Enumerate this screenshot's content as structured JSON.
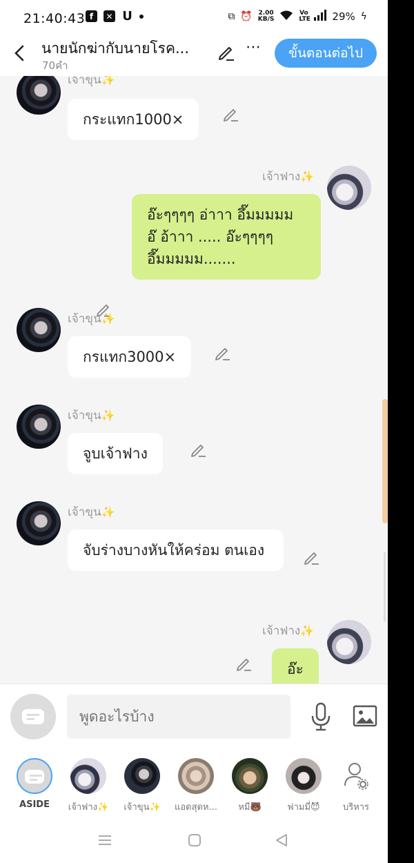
{
  "status_bar": {
    "time": "21:40:43",
    "app_icons": [
      "facebook-icon",
      "capcut-icon",
      "u-icon",
      "dot-icon"
    ],
    "speed_value": "2.00",
    "speed_unit": "KB/S",
    "network": "Vo LTE",
    "battery": "29%"
  },
  "header": {
    "title": "นายนักฆ่ากับนายโรค...",
    "word_count": "70คำ",
    "next_button": "ขั้นตอนต่อไป"
  },
  "messages": [
    {
      "sender": "เจ้าขุน",
      "text": "กระแทก1000×",
      "side": "left"
    },
    {
      "sender": "เจ้าฟาง",
      "text": "อ๊ะๆๆๆๆ อ่าาา อึ๊มมมมม อ๊ อ้าาา ..... อ๊ะๆๆๆๆ อึ๊มมมมม.......",
      "side": "right"
    },
    {
      "sender": "เจ้าขุน",
      "text": "กรแทก3000×",
      "side": "left"
    },
    {
      "sender": "เจ้าขุน",
      "text": "จูบเจ้าฟาง",
      "side": "left"
    },
    {
      "sender": "เจ้าขุน",
      "text": "จับร่างบางหันให้คร่อม ตนเอง",
      "side": "left"
    },
    {
      "sender": "เจ้าฟาง",
      "text": "อ๊ะ",
      "side": "right"
    }
  ],
  "input": {
    "placeholder": "พูดอะไรบ้าง"
  },
  "tabs": [
    {
      "label": "ASIDE"
    },
    {
      "label": "เจ้าฟาง✨"
    },
    {
      "label": "เจ้าขุน✨"
    },
    {
      "label": "แอดสุดห..."
    },
    {
      "label": "หมี🐻"
    },
    {
      "label": "ฟามมี่😈"
    },
    {
      "label": "บริหาร"
    }
  ],
  "colors": {
    "accent": "#4aa3f5",
    "my_bubble": "#d5f08d",
    "background": "#f5f5f5",
    "sparkle": "#f3c42a"
  }
}
